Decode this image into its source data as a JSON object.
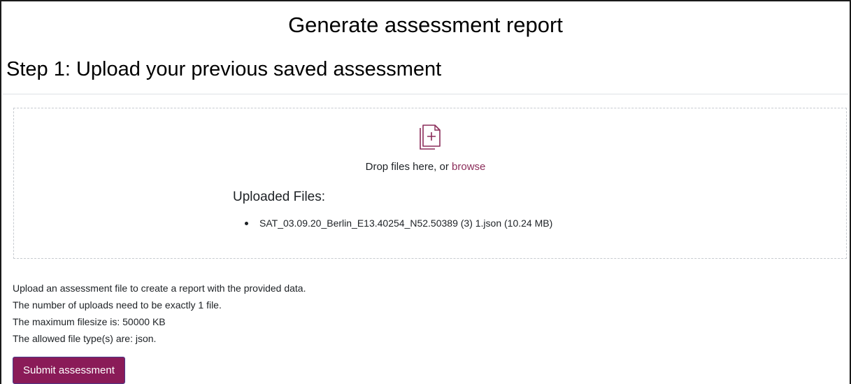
{
  "page": {
    "title": "Generate assessment report",
    "step_title": "Step 1: Upload your previous saved assessment"
  },
  "dropzone": {
    "icon": "file-add-icon",
    "prompt_prefix": "Drop files here, or ",
    "browse_label": "browse",
    "uploaded_heading": "Uploaded Files:",
    "files": [
      {
        "label": "SAT_03.09.20_Berlin_E13.40254_N52.50389 (3) 1.json (10.24 MB)"
      }
    ]
  },
  "info": {
    "lines": [
      "Upload an assessment file to create a report with the provided data.",
      "The number of uploads need to be exactly 1 file.",
      "The maximum filesize is: 50000 KB",
      "The allowed file type(s) are: json."
    ]
  },
  "actions": {
    "submit_label": "Submit assessment"
  },
  "colors": {
    "accent": "#8a1b58",
    "link": "#8b2d5a",
    "icon": "#8b2d5a"
  }
}
